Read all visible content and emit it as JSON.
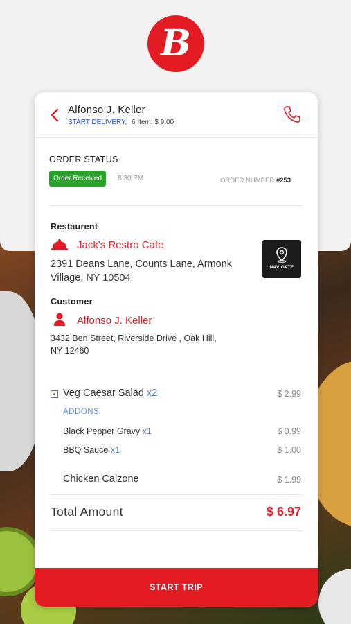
{
  "header": {
    "customer_name": "Alfonso J. Keller",
    "start_delivery_link": "START DELIVERY,",
    "items_summary": "6 Item: $ 9.00"
  },
  "order_status": {
    "title": "ORDER STATUS",
    "badge": "Order Received",
    "time": "8:30 PM",
    "order_number_label": "ORDER NUMBER",
    "order_number": "#253"
  },
  "restaurant": {
    "label": "Restaurent",
    "name": "Jack's Restro Cafe",
    "address_line1": "2391 Deans Lane, Counts Lane, Armonk",
    "address_line2": "Village, NY 10504",
    "navigate_label": "NAVIGATE"
  },
  "customer": {
    "label": "Customer",
    "name": "Alfonso J. Keller",
    "address_line1": "3432 Ben Street, Riverside Drive , Oak Hill,",
    "address_line2": "NY 12460"
  },
  "items": [
    {
      "name": "Veg Caesar Salad",
      "qty": "x2",
      "price": "$ 2.99"
    },
    {
      "name": "Chicken Calzone",
      "qty": "",
      "price": "$ 1.99"
    }
  ],
  "addons": {
    "label": "ADDONS",
    "list": [
      {
        "name": "Black Pepper Gravy",
        "qty": "x1",
        "price": "$ 0.99"
      },
      {
        "name": "BBQ Sauce",
        "qty": "x1",
        "price": "$ 1.00"
      }
    ]
  },
  "total": {
    "label": "Total Amount",
    "value": "$ 6.97"
  },
  "start_trip_label": "START TRIP",
  "colors": {
    "brand_red": "#e31b23",
    "green": "#2aa12a",
    "link_blue": "#1a4ad6"
  },
  "icons": [
    "back-arrow-icon",
    "phone-icon",
    "restaurant-cloche-icon",
    "location-pin-icon",
    "person-icon",
    "veg-indicator-icon"
  ]
}
